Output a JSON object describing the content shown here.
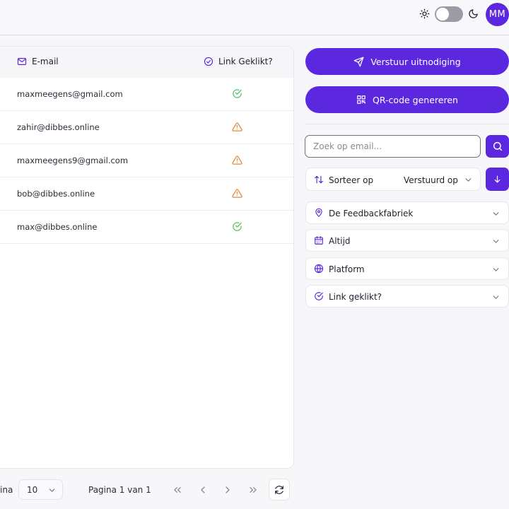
{
  "header": {
    "avatar_initials": "MM",
    "theme_toggle_on": false
  },
  "table": {
    "columns": {
      "email": "E-mail",
      "link_clicked": "Link Geklikt?"
    },
    "rows": [
      {
        "email": "maxmeegens@gmail.com",
        "link_clicked": "check-circle-icon"
      },
      {
        "email": "zahir@dibbes.online",
        "link_clicked": "warning-triangle-icon"
      },
      {
        "email": "maxmeegens9@gmail.com",
        "link_clicked": "warning-triangle-icon"
      },
      {
        "email": "bob@dibbes.online",
        "link_clicked": "warning-triangle-icon"
      },
      {
        "email": "max@dibbes.online",
        "link_clicked": "check-circle-icon"
      }
    ]
  },
  "pagination": {
    "rows_label_fragment": "ina",
    "rows_per_page": "10",
    "page_info": "Pagina 1 van 1"
  },
  "actions": {
    "send_invite": "Verstuur uitnodiging",
    "qr_code": "QR-code genereren"
  },
  "search": {
    "placeholder": "Zoek op email..."
  },
  "sort": {
    "label": "Sorteer op",
    "value": "Verstuurd op"
  },
  "filters": {
    "location": "De Feedbackfabriek",
    "period": "Altijd",
    "platform": "Platform",
    "link_clicked": "Link geklikt?"
  },
  "colors": {
    "accent": "#5b28df",
    "success": "#4cc36a",
    "warning": "#e0883a"
  }
}
